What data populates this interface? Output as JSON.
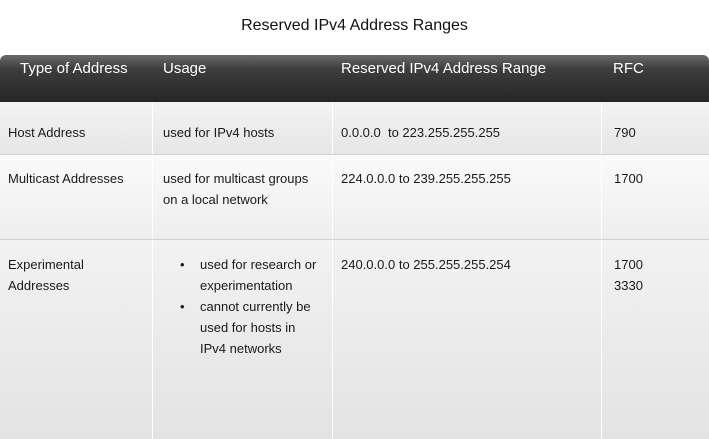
{
  "title": "Reserved IPv4 Address Ranges",
  "headers": {
    "type": "Type of Address",
    "usage": "Usage",
    "range": "Reserved IPv4 Address Range",
    "rfc": "RFC"
  },
  "rows": [
    {
      "type": "Host Address",
      "usage": "used for IPv4 hosts",
      "range": "0.0.0.0  to 223.255.255.255",
      "rfc": [
        "790"
      ]
    },
    {
      "type": "Multicast Addresses",
      "usage": "used for multicast groups on a local network",
      "range": "224.0.0.0 to 239.255.255.255",
      "rfc": [
        "1700"
      ]
    },
    {
      "type": "Experimental Addresses",
      "usage": [
        "used for research or experimentation",
        "cannot currently be used for hosts in IPv4 networks"
      ],
      "range": "240.0.0.0 to 255.255.255.254",
      "rfc": [
        "1700",
        "3330"
      ]
    }
  ]
}
